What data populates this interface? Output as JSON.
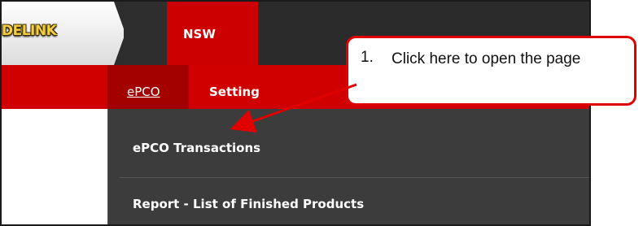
{
  "header": {
    "logo_text": "DELINK",
    "active_tab": "NSW"
  },
  "submenu": {
    "items": [
      {
        "label": "ePCO"
      },
      {
        "label": "Setting"
      }
    ]
  },
  "dropdown": {
    "items": [
      {
        "label": "ePCO Transactions"
      },
      {
        "label": "Report - List of Finished Products"
      }
    ]
  },
  "callout": {
    "number": "1.",
    "text": "Click here to open the page"
  },
  "colors": {
    "accent_red": "#cc0000",
    "dark_nav": "#2d2d2d",
    "dropdown_bg": "#3c3c3c"
  }
}
